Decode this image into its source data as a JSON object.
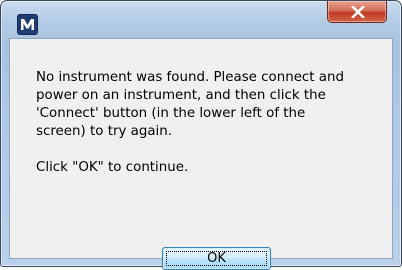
{
  "dialog": {
    "title": "",
    "app_icon": "M-icon",
    "close_icon": "close-x-icon",
    "message": "No instrument was found. Please connect and\npower on an instrument, and then click the\n'Connect' button (in the lower left of the\nscreen) to try again.\n\nClick \"OK\" to continue.",
    "ok_label": "OK"
  },
  "colors": {
    "close_button": "#c0391f",
    "app_icon_bg": "#1f3d73",
    "client_bg": "#f0f0f0",
    "ok_border": "#3c7fb1"
  }
}
